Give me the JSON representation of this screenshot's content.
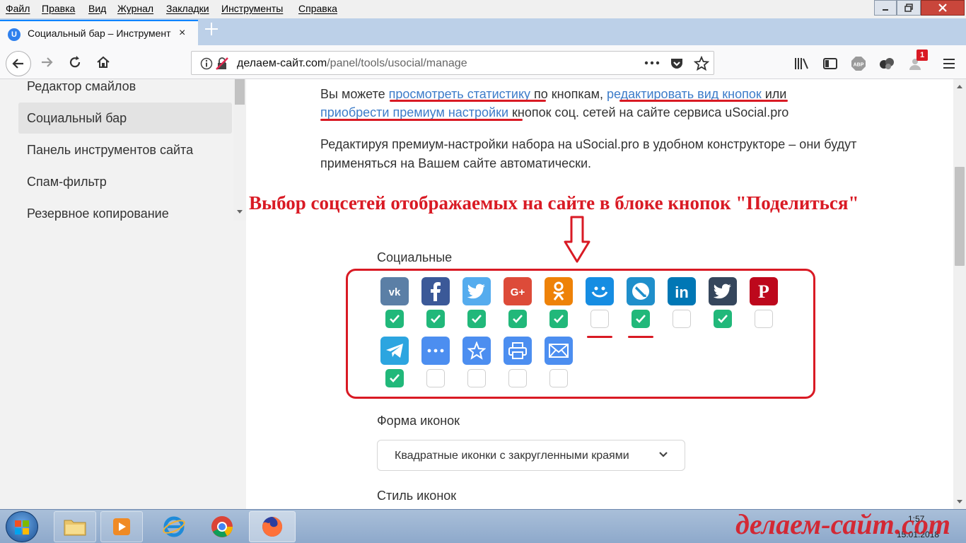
{
  "menubar": {
    "items": [
      "Файл",
      "Правка",
      "Вид",
      "Журнал",
      "Закладки",
      "Инструменты",
      "Справка"
    ]
  },
  "tab": {
    "favicon_letter": "U",
    "title": "Социальный бар – Инструмент",
    "close": "×"
  },
  "urlbar": {
    "host": "делаем-сайт.com",
    "path": "/panel/tools/usocial/manage"
  },
  "toolbar": {
    "notification_badge": "1",
    "abp_label": "ABP"
  },
  "sidebar": {
    "items": [
      {
        "label": "Редактор смайлов",
        "active": false
      },
      {
        "label": "Социальный бар",
        "active": true
      },
      {
        "label": "Панель инструментов сайта",
        "active": false
      },
      {
        "label": "Спам-фильтр",
        "active": false
      },
      {
        "label": "Резервное копирование",
        "active": false
      }
    ]
  },
  "main": {
    "p1_a": "Вы можете ",
    "link_stats": "просмотреть статистику",
    "p1_b": " по кнопкам, ",
    "link_edit": "редактировать вид кнопок",
    "p1_c": " или ",
    "link_premium": "приобрести премиум настройки",
    "p1_d": " кнопок соц. сетей на сайте сервиса uSocial.pro",
    "p2": "Редактируя премиум-настройки набора на uSocial.pro в удобном конструкторе – они будут применяться на Вашем сайте автоматически.",
    "annotation": "Выбор соцсетей отображаемых на сайте в блоке кнопок \"Поделиться\"",
    "social_label": "Социальные",
    "socials": [
      {
        "name": "vk",
        "glyph": "vk",
        "color": "#5b7fa6",
        "checked": true
      },
      {
        "name": "facebook",
        "glyph": "f",
        "color": "#3b5998",
        "checked": true
      },
      {
        "name": "twitter",
        "glyph": "t",
        "color": "#55acee",
        "checked": true
      },
      {
        "name": "google-plus",
        "glyph": "G+",
        "color": "#dd4b39",
        "checked": true
      },
      {
        "name": "odnoklassniki",
        "glyph": "ok",
        "color": "#ee8208",
        "checked": true
      },
      {
        "name": "moimir",
        "glyph": "mm",
        "color": "#168de2",
        "checked": false
      },
      {
        "name": "livejournal",
        "glyph": "lj",
        "color": "#1f8fcb",
        "checked": true
      },
      {
        "name": "linkedin",
        "glyph": "in",
        "color": "#0077b5",
        "checked": false
      },
      {
        "name": "tumblr",
        "glyph": "t",
        "color": "#35465c",
        "checked": true
      },
      {
        "name": "pinterest",
        "glyph": "P",
        "color": "#bd081c",
        "checked": false
      },
      {
        "name": "telegram",
        "glyph": "tg",
        "color": "#2ca5e0",
        "checked": true
      },
      {
        "name": "more",
        "glyph": "…",
        "color": "#4c8ef0",
        "checked": false
      },
      {
        "name": "bookmark",
        "glyph": "☆",
        "color": "#4c8ef0",
        "checked": false
      },
      {
        "name": "print",
        "glyph": "pr",
        "color": "#4c8ef0",
        "checked": false
      },
      {
        "name": "email",
        "glyph": "@",
        "color": "#4c8ef0",
        "checked": false
      }
    ],
    "form_label": "Форма иконок",
    "shape_value": "Квадратные иконки с закругленными краями",
    "style_label": "Стиль иконок"
  },
  "taskbar": {
    "time": "1:57",
    "date": "15.01.2018",
    "watermark": "делаем-сайт.com"
  },
  "colors": {
    "accent_red": "#d91a24",
    "link": "#3d7cc9",
    "check_green": "#21b87a"
  }
}
